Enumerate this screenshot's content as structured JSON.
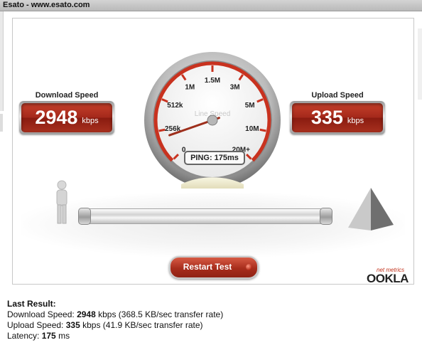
{
  "window": {
    "title": "Esato - www.esato.com"
  },
  "speedtest": {
    "download": {
      "label": "Download Speed",
      "value": "2948",
      "unit": "kbps"
    },
    "upload": {
      "label": "Upload Speed",
      "value": "335",
      "unit": "kbps"
    },
    "gauge": {
      "title": "Line Speed",
      "ticks": [
        "0",
        "256k",
        "512k",
        "1M",
        "1.5M",
        "3M",
        "5M",
        "10M",
        "20M+"
      ],
      "ping_label": "PING: 175ms",
      "needle_value": "256k"
    },
    "restart_label": "Restart Test",
    "brand": "OOKLA",
    "brand_tagline": "net metrics"
  },
  "results": {
    "heading": "Last Result:",
    "download_label": "Download Speed: ",
    "download_value": "2948",
    "download_suffix": " kbps (368.5 KB/sec transfer rate)",
    "upload_label": "Upload Speed: ",
    "upload_value": "335",
    "upload_suffix": " kbps (41.9 KB/sec transfer rate)",
    "latency_label": "Latency: ",
    "latency_value": "175",
    "latency_suffix": " ms"
  },
  "colors": {
    "accent_red": "#a5291b",
    "gauge_red": "#c8321f"
  }
}
